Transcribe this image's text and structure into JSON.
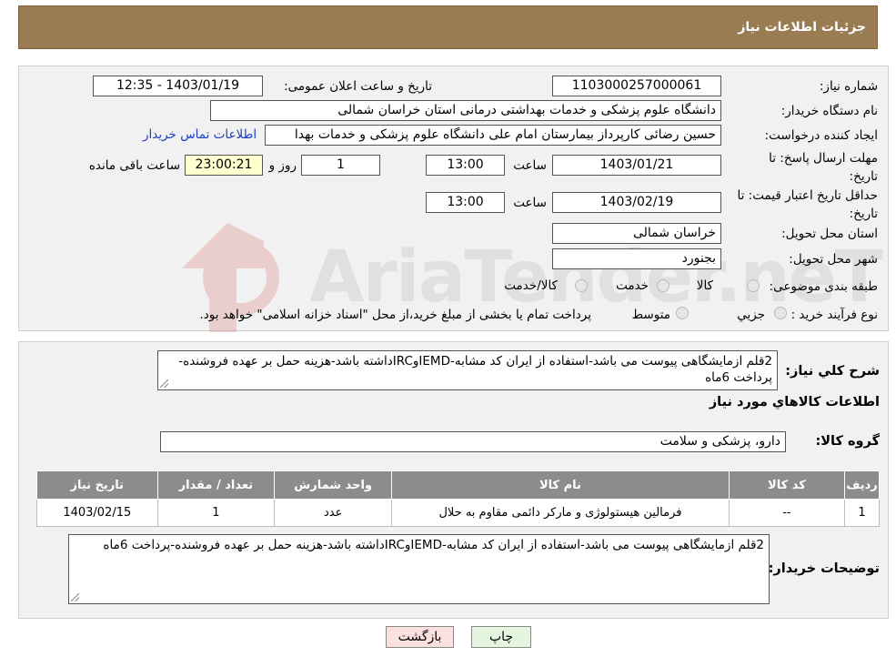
{
  "header": {
    "title": "جزئیات اطلاعات نیاز"
  },
  "form": {
    "need_number_label": "شماره نیاز:",
    "need_number": "1103000257000061",
    "announce_label": "تاریخ و ساعت اعلان عمومی:",
    "announce_value": "1403/01/19 - 12:35",
    "buyer_org_label": "نام دستگاه خریدار:",
    "buyer_org": "دانشگاه علوم پزشکی و خدمات بهداشتی درمانی استان خراسان شمالی",
    "creator_label": "ایجاد کننده درخواست:",
    "creator": "حسین رضائی کارپرداز بیمارستان امام علی دانشگاه علوم پزشکی و خدمات بهدا",
    "contact_link": "اطلاعات تماس خریدار",
    "deadline_label_1": "مهلت ارسال پاسخ: تا",
    "deadline_label_2": "تاریخ:",
    "deadline_date": "1403/01/21",
    "time_label": "ساعت",
    "deadline_time": "13:00",
    "days_value": "1",
    "days_label": "روز و",
    "remaining_time": "23:00:21",
    "remaining_label": "ساعت باقی مانده",
    "validity_label_1": "حداقل تاریخ اعتبار قیمت: تا",
    "validity_label_2": "تاریخ:",
    "validity_date": "1403/02/19",
    "validity_time_label": "ساعت",
    "validity_time": "13:00",
    "province_label": "استان محل تحویل:",
    "province": "خراسان شمالی",
    "city_label": "شهر محل تحویل:",
    "city": "بجنورد",
    "category_label": "طبقه بندی موضوعی:",
    "category_options": [
      "کالا",
      "خدمت",
      "کالا/خدمت"
    ],
    "purchase_type_label": "نوع فرآیند خرید :",
    "purchase_options": [
      "جزیي",
      "متوسط"
    ],
    "payment_note": "پرداخت تمام یا بخشی از مبلغ خرید،از محل \"اسناد خزانه اسلامی\" خواهد بود."
  },
  "details": {
    "summary_label": "شرح کلي نیاز:",
    "summary_text": "2قلم ازمایشگاهی پیوست می باشد-استفاده از ایران کد مشابه-IEMDوIRCداشته باشد-هزینه حمل بر عهده فروشنده-پرداخت 6ماه",
    "items_title": "اطلاعات کالاهاي مورد نیاز",
    "group_label": "گروه کالا:",
    "group_value": "دارو، پزشکی و سلامت"
  },
  "table": {
    "headers": [
      "ردیف",
      "کد کالا",
      "نام کالا",
      "واحد شمارش",
      "تعداد / مقدار",
      "تاریخ نیاز"
    ],
    "rows": [
      [
        "1",
        "--",
        "فرمالین هیستولوژی و مارکر دائمی مقاوم به حلال",
        "عدد",
        "1",
        "1403/02/15"
      ]
    ]
  },
  "buyer_notes": {
    "label": "توضیحات خریدار:",
    "text": "2قلم ازمایشگاهی پیوست می باشد-استفاده از ایران کد مشابه-IEMDوIRCداشته باشد-هزینه حمل بر عهده فروشنده-پرداخت 6ماه"
  },
  "buttons": {
    "print": "چاپ",
    "back": "بازگشت"
  },
  "watermark": {
    "text": "AriaTender.neT"
  },
  "colors": {
    "header_bg": "#9a7c53",
    "table_header_bg": "#8c8c8c",
    "link": "#1a3cc8",
    "back_btn": "#fbe0e0",
    "print_btn": "#e4f6e0"
  }
}
